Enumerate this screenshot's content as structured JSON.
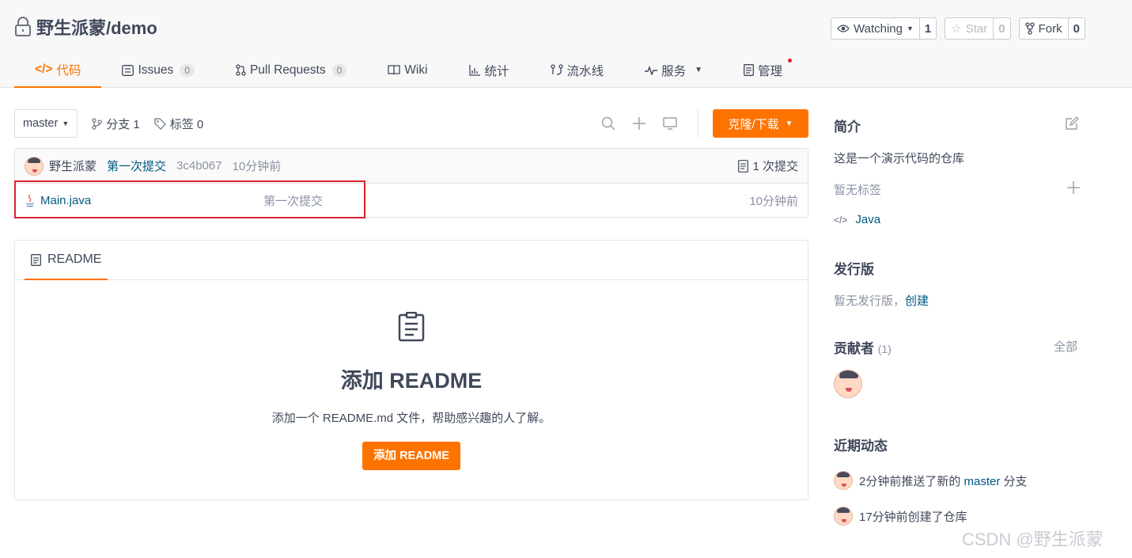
{
  "repo": {
    "owner": "野生派蒙",
    "name": "demo",
    "full_name": "野生派蒙/demo"
  },
  "actions": {
    "watch": {
      "label": "Watching",
      "count": "1"
    },
    "star": {
      "label": "Star",
      "count": "0"
    },
    "fork": {
      "label": "Fork",
      "count": "0"
    }
  },
  "tabs": [
    {
      "label": "代码",
      "active": true
    },
    {
      "label": "Issues",
      "badge": "0"
    },
    {
      "label": "Pull Requests",
      "badge": "0"
    },
    {
      "label": "Wiki"
    },
    {
      "label": "统计"
    },
    {
      "label": "流水线"
    },
    {
      "label": "服务"
    },
    {
      "label": "管理"
    }
  ],
  "branch": {
    "current": "master",
    "branches_label": "分支 1",
    "tags_label": "标签 0"
  },
  "clone_label": "克隆/下载",
  "last_commit": {
    "author": "野生派蒙",
    "message": "第一次提交",
    "sha": "3c4b067",
    "time": "10分钟前",
    "count_label": "1 次提交"
  },
  "files": [
    {
      "name": "Main.java",
      "message": "第一次提交",
      "time": "10分钟前"
    }
  ],
  "readme": {
    "tab_label": "README",
    "heading": "添加 README",
    "description": "添加一个 README.md 文件，帮助感兴趣的人了解。",
    "button_label": "添加 README"
  },
  "sidebar": {
    "intro_title": "简介",
    "intro_text": "这是一个演示代码的仓库",
    "no_tags": "暂无标签",
    "language": "Java",
    "release_title": "发行版",
    "no_release": "暂无发行版，",
    "create_link": "创建",
    "contributors_title": "贡献者",
    "contributors_count": "(1)",
    "all_link": "全部",
    "activity_title": "近期动态",
    "activities": [
      {
        "prefix": "2分钟前推送了新的",
        "link": "master",
        "suffix": "分支"
      },
      {
        "prefix": "17分钟前创建了仓库",
        "link": "",
        "suffix": ""
      }
    ]
  },
  "watermark": "CSDN @野生派蒙",
  "colors": {
    "accent": "#fe7300",
    "link": "#005980",
    "highlight_border": "#d9242a"
  }
}
